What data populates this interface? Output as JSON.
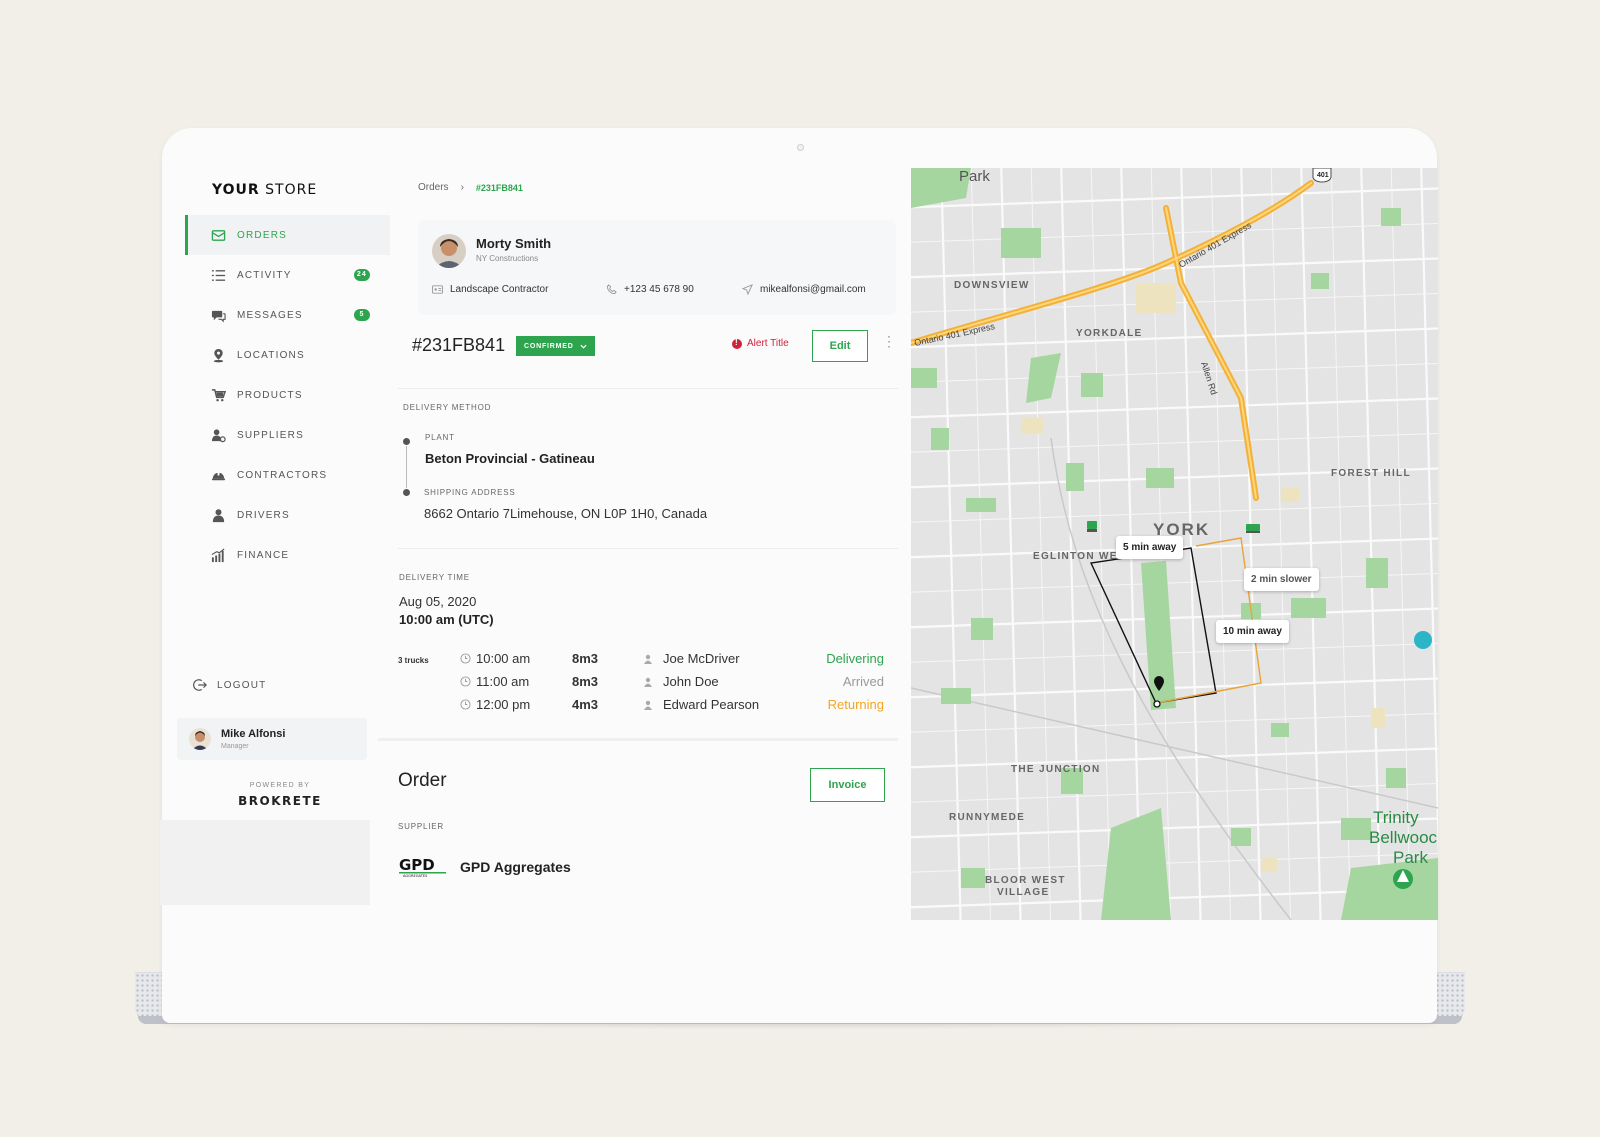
{
  "sidebar": {
    "brand_bold": "YOUR",
    "brand_rest": "STORE",
    "items": [
      {
        "label": "ORDERS",
        "active": true
      },
      {
        "label": "ACTIVITY",
        "badge": "24"
      },
      {
        "label": "MESSAGES",
        "badge": "5"
      },
      {
        "label": "LOCATIONS"
      },
      {
        "label": "PRODUCTS"
      },
      {
        "label": "SUPPLIERS"
      },
      {
        "label": "CONTRACTORS"
      },
      {
        "label": "DRIVERS"
      },
      {
        "label": "FINANCE"
      }
    ],
    "logout": "LOGOUT",
    "user": {
      "name": "Mike Alfonsi",
      "role": "Manager"
    },
    "powered_by": "POWERED BY",
    "powered_brand": "BROKRETE"
  },
  "breadcrumb": {
    "root": "Orders",
    "separator": "›",
    "current": "#231FB841"
  },
  "contact": {
    "name": "Morty Smith",
    "company": "NY Constructions",
    "type": "Landscape Contractor",
    "phone": "+123 45 678 90",
    "email": "mikealfonsi@gmail.com"
  },
  "order": {
    "id": "#231FB841",
    "status": "CONFIRMED",
    "alert": "Alert Title",
    "edit": "Edit"
  },
  "delivery": {
    "method_label": "DELIVERY METHOD",
    "plant_label": "PLANT",
    "plant": "Beton Provincial - Gatineau",
    "address_label": "SHIPPING ADDRESS",
    "address": "8662 Ontario 7Limehouse, ON L0P 1H0, Canada",
    "time_label": "DELIVERY TIME",
    "date": "Aug 05, 2020",
    "time": "10:00 am (UTC)",
    "trucks_label": "3 trucks",
    "trucks": [
      {
        "time": "10:00 am",
        "volume": "8m3",
        "driver": "Joe McDriver",
        "status": "Delivering",
        "color": "#2ea44f"
      },
      {
        "time": "11:00 am",
        "volume": "8m3",
        "driver": "John Doe",
        "status": "Arrived",
        "color": "#9a9a9a"
      },
      {
        "time": "12:00 pm",
        "volume": "4m3",
        "driver": "Edward  Pearson",
        "status": "Returning",
        "color": "#f0a623"
      }
    ]
  },
  "order_section": {
    "title": "Order",
    "invoice": "Invoice",
    "supplier_label": "SUPPLIER",
    "supplier_logo": "GPD",
    "supplier_logo_sub": "AGGREGATES",
    "supplier": "GPD Aggregates"
  },
  "map": {
    "labels": {
      "park": "Park",
      "highway": "401",
      "downsview": "DOWNSVIEW",
      "yorkdale": "YORKDALE",
      "forest_hill": "FOREST HILL",
      "york": "YORK",
      "eglinton": "EGLINTON WE",
      "junction": "THE JUNCTION",
      "runnymede": "RUNNYMEDE",
      "bloor_west": "BLOOR WEST",
      "village": "VILLAGE",
      "trinity": "Trinity",
      "bellwoods": "Bellwooc",
      "trinity_park": "Park",
      "ontario401_left": "Ontario 401 Express",
      "ontario401_right": "Ontario 401 Express",
      "allen_rd": "Allen Rd"
    },
    "pills": {
      "five": "5 min away",
      "two": "2 min slower",
      "ten": "10 min away"
    }
  },
  "colors": {
    "accent": "#2ea44f",
    "alert": "#d0213b",
    "returning": "#f0a623",
    "route_alt": "#e8a43a"
  }
}
